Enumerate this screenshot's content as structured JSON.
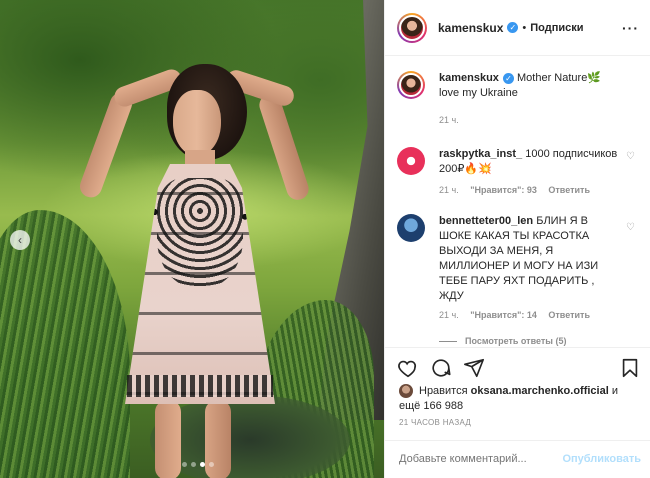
{
  "post": {
    "username": "kamenskux",
    "separator": "•",
    "follow_label": "Подписки",
    "more_icon": "more-dots-icon"
  },
  "caption": {
    "username": "kamenskux",
    "text": "Mother Nature🌿love my Ukraine",
    "time": "21 ч."
  },
  "comments": [
    {
      "username": "raskpytka_inst_",
      "text": "1000 подписчиков 200₽🔥💥",
      "time": "21 ч.",
      "likes": "\"Нравится\": 93",
      "reply": "Ответить"
    },
    {
      "username": "bennetteter00_len",
      "text": "БЛИН Я В ШОКЕ КАКАЯ ТЫ КРАСОТКА ВЫХОДИ ЗА МЕНЯ, Я МИЛЛИОНЕР И МОГУ НА ИЗИ ТЕБЕ ПАРУ ЯХТ ПОДАРИТЬ , ЖДУ",
      "time": "21 ч.",
      "likes": "\"Нравится\": 14",
      "reply": "Ответить"
    }
  ],
  "view_replies": "Посмотреть ответы (5)",
  "likes": {
    "prefix": "Нравится",
    "user": "oksana.marchenko.official",
    "suffix": "и ещё 166 988"
  },
  "timestamp": "21 ЧАСОВ НАЗАД",
  "add_comment": {
    "placeholder": "Добавьте комментарий...",
    "publish_label": "Опубликовать"
  },
  "media": {
    "carousel_index": 3,
    "carousel_total": 4
  },
  "colors": {
    "verified": "#3897f0",
    "publish": "#b2dffc",
    "secondary_text": "#8e8e8e"
  }
}
